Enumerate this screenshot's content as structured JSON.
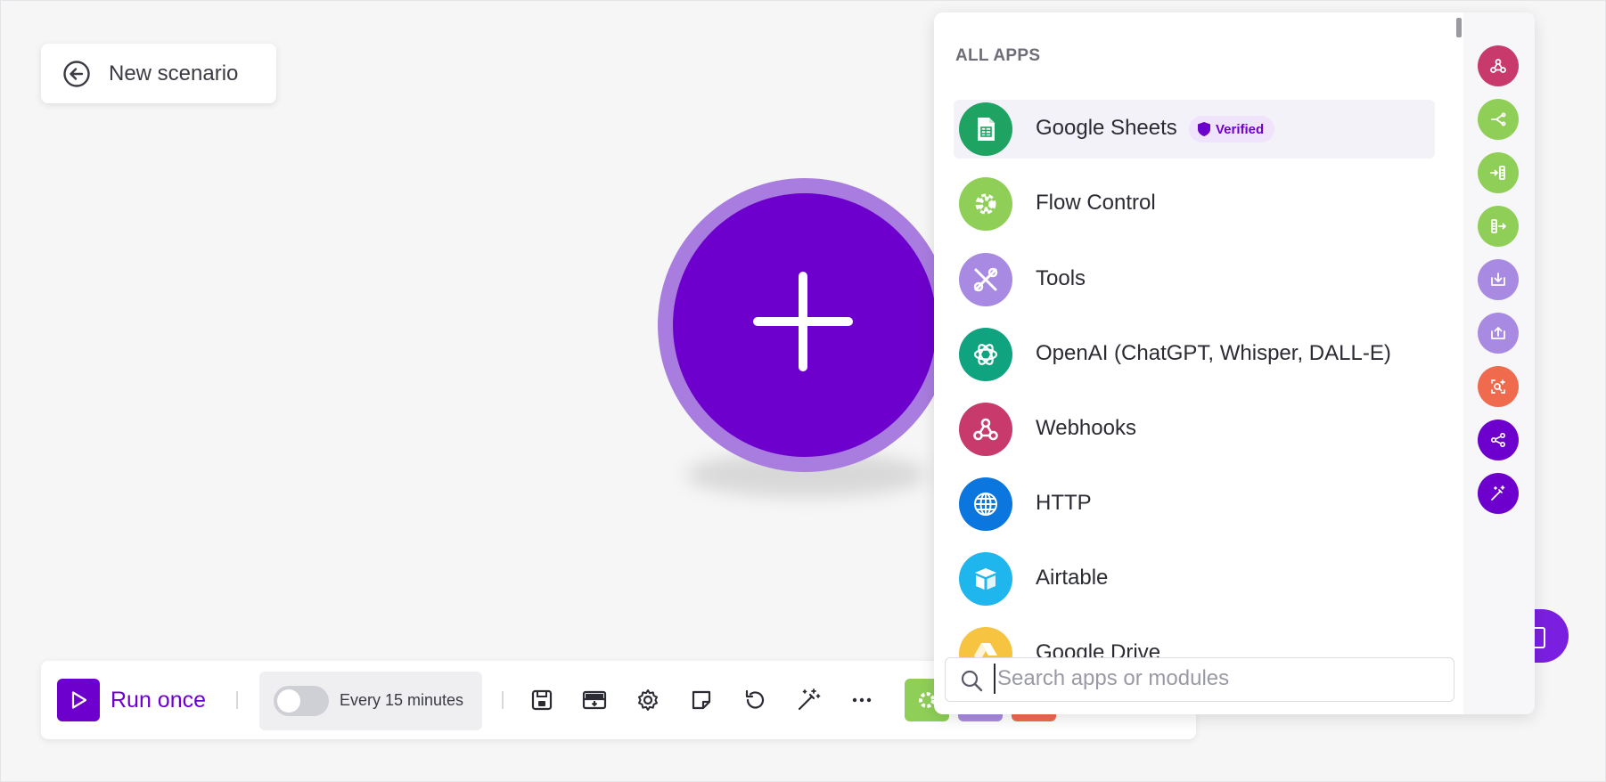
{
  "header": {
    "back_label": "New scenario"
  },
  "toolbar": {
    "run_label": "Run once",
    "schedule_label": "Every 15 minutes",
    "chips": [
      {
        "name": "flow-control-chip",
        "color": "#8fcf58"
      },
      {
        "name": "tools-chip",
        "color": "#a98ae3"
      },
      {
        "name": "text-parser-chip",
        "color": "#f06b4d"
      }
    ]
  },
  "panel": {
    "title": "ALL APPS",
    "search_placeholder": "Search apps or modules",
    "apps": [
      {
        "name": "Google Sheets",
        "icon": "google-sheets-icon",
        "color": "#1ea362",
        "badge": "Verified"
      },
      {
        "name": "Flow Control",
        "icon": "gear-icon",
        "color": "#8fcf58"
      },
      {
        "name": "Tools",
        "icon": "tools-icon",
        "color": "#a98ae3"
      },
      {
        "name": "OpenAI (ChatGPT, Whisper, DALL-E)",
        "icon": "openai-icon",
        "color": "#10a37f"
      },
      {
        "name": "Webhooks",
        "icon": "webhook-icon",
        "color": "#c73a6b"
      },
      {
        "name": "HTTP",
        "icon": "globe-icon",
        "color": "#0b76dd"
      },
      {
        "name": "Airtable",
        "icon": "airtable-icon",
        "color": "#1fb6ee"
      },
      {
        "name": "Google Drive",
        "icon": "google-drive-icon",
        "color": "#f7c442"
      }
    ],
    "side_buttons": [
      {
        "name": "webhooks-shortcut",
        "icon": "webhook-icon",
        "color": "#c73a6b"
      },
      {
        "name": "router-shortcut",
        "icon": "router-icon",
        "color": "#8fcf58"
      },
      {
        "name": "aggregator-shortcut",
        "icon": "aggregator-icon",
        "color": "#8fcf58"
      },
      {
        "name": "iterator-shortcut",
        "icon": "iterator-icon",
        "color": "#8fcf58"
      },
      {
        "name": "download-shortcut",
        "icon": "download-icon",
        "color": "#a98ae3"
      },
      {
        "name": "upload-shortcut",
        "icon": "upload-icon",
        "color": "#a98ae3"
      },
      {
        "name": "search-shortcut",
        "icon": "search-plus-icon",
        "color": "#f06b4d"
      },
      {
        "name": "share-shortcut",
        "icon": "share-icon",
        "color": "#6d00cc"
      },
      {
        "name": "magic-shortcut",
        "icon": "magic-wand-icon",
        "color": "#6d00cc"
      }
    ]
  },
  "colors": {
    "accent": "#6d00cc",
    "add_ring": "#a97cdf"
  }
}
